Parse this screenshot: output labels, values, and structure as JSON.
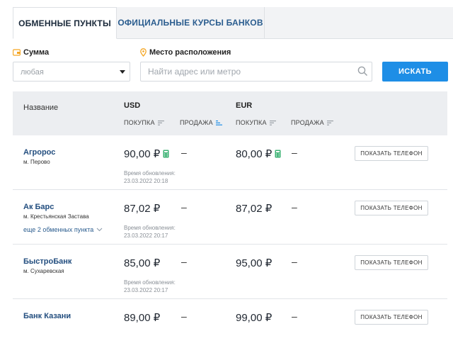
{
  "tabs": [
    {
      "label": "ОБМЕННЫЕ ПУНКТЫ",
      "active": true
    },
    {
      "label": "ОФИЦИАЛЬНЫЕ КУРСЫ БАНКОВ",
      "active": false
    }
  ],
  "filters": {
    "amount_label": "Сумма",
    "amount_value": "любая",
    "location_label": "Место расположения",
    "location_placeholder": "Найти адрес или метро",
    "search_button": "ИСКАТЬ"
  },
  "table": {
    "col_name": "Название",
    "currencies": [
      "USD",
      "EUR"
    ],
    "sort_buy": "ПОКУПКА",
    "sort_sell": "ПРОДАЖА",
    "phone_button": "ПОКАЗАТЬ ТЕЛЕФОН",
    "dash": "–",
    "update_label": "Время обновления:",
    "rows": [
      {
        "name": "Агророс",
        "metro": "м. Перово",
        "usd_buy": "90,00 ₽",
        "eur_buy": "80,00 ₽",
        "updated": "23.03.2022 20:18",
        "more": ""
      },
      {
        "name": "Ак Барс",
        "metro": "м. Крестьянская Застава",
        "usd_buy": "87,02 ₽",
        "eur_buy": "87,02 ₽",
        "updated": "23.03.2022 20:17",
        "more": "еще 2 обменных пункта"
      },
      {
        "name": "БыстроБанк",
        "metro": "м. Сухаревская",
        "usd_buy": "85,00 ₽",
        "eur_buy": "95,00 ₽",
        "updated": "23.03.2022 20:17",
        "more": ""
      },
      {
        "name": "Банк Казани",
        "metro": "",
        "usd_buy": "89,00 ₽",
        "eur_buy": "99,00 ₽",
        "updated": "",
        "more": ""
      }
    ]
  },
  "colors": {
    "accent": "#1e8ee6",
    "link": "#234e7f",
    "calc_icon": "#3bb273",
    "header_bg": "#eceef1"
  }
}
